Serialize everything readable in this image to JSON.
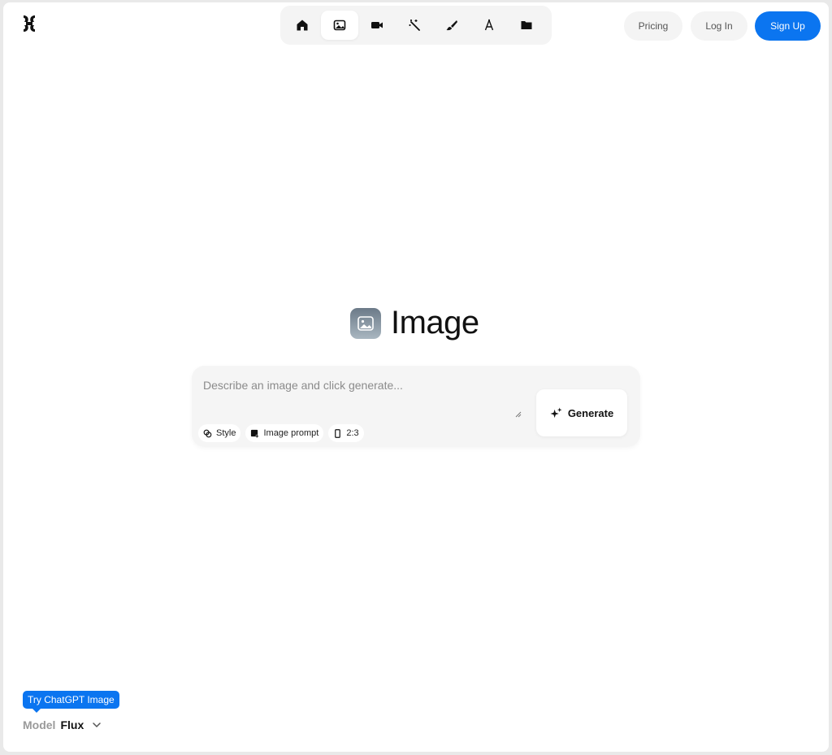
{
  "header": {
    "logo_icon": "app-logo-icon",
    "nav": [
      {
        "icon": "home-icon",
        "active": false
      },
      {
        "icon": "image-icon",
        "active": true
      },
      {
        "icon": "video-icon",
        "active": false
      },
      {
        "icon": "magic-wand-icon",
        "active": false
      },
      {
        "icon": "brush-icon",
        "active": false
      },
      {
        "icon": "font-icon",
        "active": false
      },
      {
        "icon": "folder-icon",
        "active": false
      }
    ],
    "pricing_label": "Pricing",
    "login_label": "Log In",
    "signup_label": "Sign Up"
  },
  "hero": {
    "icon": "image-icon",
    "title": "Image"
  },
  "prompt": {
    "placeholder": "Describe an image and click generate...",
    "value": "",
    "chips": {
      "style_label": "Style",
      "image_prompt_label": "Image prompt",
      "aspect_label": "2:3"
    },
    "generate_label": "Generate"
  },
  "footer": {
    "tooltip": "Try ChatGPT Image",
    "model_label": "Model",
    "model_value": "Flux"
  },
  "colors": {
    "accent": "#0b75f0",
    "surface": "#f4f4f4",
    "background": "#ffffff"
  }
}
